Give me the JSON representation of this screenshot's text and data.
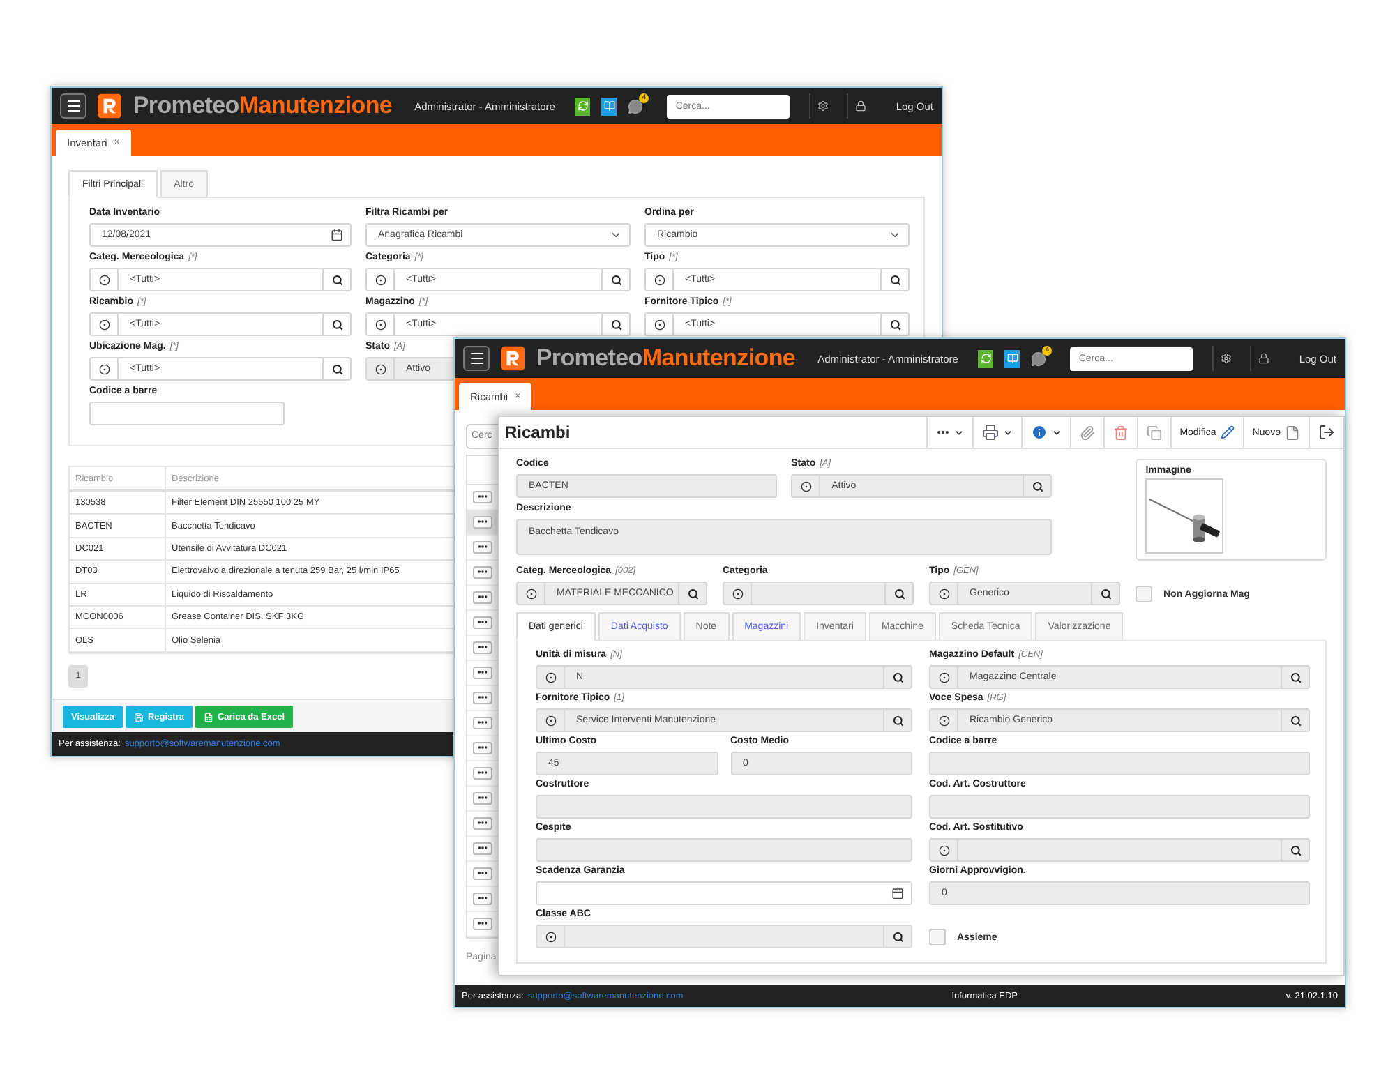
{
  "back_window": {
    "header": {
      "brand": {
        "first": "Prometeo",
        "second": "Manutenzione"
      },
      "user": "Administrator - Amministratore",
      "badge": "4",
      "search": {
        "placeholder": "Cerca..."
      },
      "logout": "Log Out"
    },
    "tabs": [
      {
        "label": "Inventari",
        "close": "×",
        "selected": true
      }
    ],
    "filter_tabs": [
      {
        "label": "Filtri Principali",
        "selected": true
      },
      {
        "label": "Altro",
        "selected": false
      }
    ],
    "form_rows": [
      [
        {
          "kind": "date",
          "label": "Data Inventario",
          "value": "12/08/2021",
          "disabled": false
        },
        {
          "kind": "select",
          "label": "Filtra Ricambi per",
          "value": "Anagrafica Ricambi",
          "disabled": false
        },
        {
          "kind": "select",
          "label": "Ordina per",
          "value": "Ricambio",
          "disabled": false
        }
      ],
      [
        {
          "kind": "lookup",
          "label": "Categ. Merceologica",
          "code": "[*]",
          "value": "<Tutti>",
          "disabled": false
        },
        {
          "kind": "lookup",
          "label": "Categoria",
          "code": "[*]",
          "value": "<Tutti>",
          "disabled": false
        },
        {
          "kind": "lookup",
          "label": "Tipo",
          "code": "[*]",
          "value": "<Tutti>",
          "disabled": false
        }
      ],
      [
        {
          "kind": "lookup",
          "label": "Ricambio",
          "code": "[*]",
          "value": "<Tutti>",
          "disabled": false
        },
        {
          "kind": "lookup",
          "label": "Magazzino",
          "code": "[*]",
          "value": "<Tutti>",
          "disabled": false
        },
        {
          "kind": "lookup",
          "label": "Fornitore Tipico",
          "code": "[*]",
          "value": "<Tutti>",
          "disabled": false
        }
      ],
      [
        {
          "kind": "lookup",
          "label": "Ubicazione Mag.",
          "code": "[*]",
          "value": "<Tutti>",
          "disabled": false
        },
        {
          "kind": "lookup",
          "label": "Stato",
          "code": "[A]",
          "value": "Attivo",
          "disabled": true
        }
      ],
      [
        {
          "kind": "short",
          "label": "Codice a barre",
          "disabled": false
        }
      ]
    ],
    "table": {
      "columns": [
        "Ricambio",
        "Descrizione"
      ],
      "rows": [
        [
          "130538",
          "Filter Element DIN 25550 100 25 MY"
        ],
        [
          "BACTEN",
          "Bacchetta Tendicavo"
        ],
        [
          "DC021",
          "Utensile di Avvitatura DC021"
        ],
        [
          "DT03",
          "Elettrovalvola direzionale a tenuta 259 Bar, 25 l/min IP65"
        ],
        [
          "LR",
          "Liquido di Riscaldamento"
        ],
        [
          "MCON0006",
          "Grease Container DIS. SKF 3KG"
        ],
        [
          "OLS",
          "Olio Selenia"
        ]
      ]
    },
    "pagination": [
      {
        "label": "1",
        "selected": true
      }
    ],
    "buttons": [
      {
        "kind": "view",
        "label": "Visualizza"
      },
      {
        "kind": "save",
        "label": "Registra"
      },
      {
        "kind": "excel",
        "label": "Carica da Excel"
      }
    ],
    "footer": {
      "label": "Per assistenza:",
      "link": "supporto@softwaremanutenzione.com"
    }
  },
  "front_window": {
    "header": {
      "brand": {
        "first": "Prometeo",
        "second": "Manutenzione"
      },
      "user": "Administrator - Amministratore",
      "badge": "4",
      "search": {
        "placeholder": "Cerca..."
      },
      "logout": "Log Out"
    },
    "tabs": [
      {
        "label": "Ricambi",
        "close": "×",
        "selected": true
      }
    ],
    "list": {
      "search": {
        "placeholder": "Cerc"
      },
      "rows": [
        {
          "selected": false
        },
        {
          "selected": true
        },
        {
          "selected": false
        },
        {
          "selected": false
        },
        {
          "selected": false
        },
        {
          "selected": false
        },
        {
          "selected": false
        },
        {
          "selected": false
        },
        {
          "selected": false
        },
        {
          "selected": false
        },
        {
          "selected": false
        },
        {
          "selected": false
        },
        {
          "selected": false
        },
        {
          "selected": false
        },
        {
          "selected": false
        },
        {
          "selected": false
        },
        {
          "selected": false
        },
        {
          "selected": false
        }
      ],
      "pager": "Pagina"
    },
    "dialog": {
      "title": "Ricambi",
      "toolbar": [
        {
          "kind": "more",
          "dropdown": true
        },
        {
          "kind": "print",
          "dropdown": true
        },
        {
          "kind": "info",
          "dropdown": true
        },
        {
          "kind": "attach",
          "dropdown": false
        },
        {
          "kind": "delete",
          "dropdown": false
        },
        {
          "kind": "copy",
          "dropdown": false
        },
        {
          "kind": "edit",
          "label": "Modifica",
          "dropdown": false
        },
        {
          "kind": "new",
          "label": "Nuovo",
          "dropdown": false
        },
        {
          "kind": "exit",
          "dropdown": false
        }
      ],
      "top_rows": [
        [
          {
            "kind": "text",
            "label": "Codice",
            "value": "BACTEN",
            "disabled": true
          },
          {
            "kind": "lookup",
            "label": "Stato",
            "code": "[A]",
            "value": "Attivo",
            "disabled": true
          }
        ],
        [
          {
            "kind": "textarea",
            "label": "Descrizione",
            "value": "Bacchetta Tendicavo",
            "disabled": true
          }
        ]
      ],
      "image": {
        "label": "Immagine",
        "kind": "picture"
      },
      "third_row": [
        {
          "kind": "lookup",
          "label": "Categ. Merceologica",
          "code": "[002]",
          "value": "MATERIALE MECCANICO",
          "disabled": true
        },
        {
          "kind": "lookup",
          "label": "Categoria",
          "disabled": true
        },
        {
          "kind": "lookup",
          "label": "Tipo",
          "code": "[GEN]",
          "value": "Generico",
          "disabled": true
        },
        {
          "kind": "checkbox",
          "label": "Non Aggiorna Mag",
          "checked": false
        }
      ],
      "tabs": [
        {
          "label": "Dati generici",
          "selected": true,
          "highlighted": false
        },
        {
          "label": "Dati Acquisto",
          "selected": false,
          "highlighted": true
        },
        {
          "label": "Note",
          "selected": false,
          "highlighted": false
        },
        {
          "label": "Magazzini",
          "selected": false,
          "highlighted": true
        },
        {
          "label": "Inventari",
          "selected": false,
          "highlighted": false
        },
        {
          "label": "Macchine",
          "selected": false,
          "highlighted": false
        },
        {
          "label": "Scheda Tecnica",
          "selected": false,
          "highlighted": false
        },
        {
          "label": "Valorizzazione",
          "selected": false,
          "highlighted": false
        }
      ],
      "tab_rows": [
        [
          {
            "kind": "lookup",
            "label": "Unità di misura",
            "code": "[N]",
            "value": "N",
            "disabled": true
          },
          {
            "kind": "lookup",
            "label": "Magazzino Default",
            "code": "[CEN]",
            "value": "Magazzino Centrale",
            "disabled": true
          }
        ],
        [
          {
            "kind": "lookup",
            "label": "Fornitore Tipico",
            "code": "[1]",
            "value": "Service Interventi Manutenzione",
            "disabled": true
          },
          {
            "kind": "lookup",
            "label": "Voce Spesa",
            "code": "[RG]",
            "value": "Ricambio Generico",
            "disabled": true
          }
        ],
        [
          {
            "kind": "pair",
            "fields": [
              {
                "kind": "text",
                "label": "Ultimo Costo",
                "value": "45",
                "disabled": true
              },
              {
                "kind": "text",
                "label": "Costo Medio",
                "value": "0",
                "disabled": true
              }
            ]
          },
          {
            "kind": "text",
            "label": "Codice a barre",
            "disabled": true
          }
        ],
        [
          {
            "kind": "text",
            "label": "Costruttore",
            "disabled": true
          },
          {
            "kind": "text",
            "label": "Cod. Art. Costruttore",
            "disabled": true
          }
        ],
        [
          {
            "kind": "text",
            "label": "Cespite",
            "disabled": true
          },
          {
            "kind": "lookup",
            "label": "Cod. Art. Sostitutivo",
            "disabled": true
          }
        ],
        [
          {
            "kind": "date",
            "label": "Scadenza Garanzia",
            "disabled": false
          },
          {
            "kind": "text",
            "label": "Giorni Approvvigion.",
            "value": "0",
            "disabled": true
          }
        ],
        [
          {
            "kind": "lookup",
            "label": "Classe ABC",
            "disabled": true
          },
          {
            "kind": "checkbox",
            "label": "Assieme",
            "checked": false
          }
        ]
      ]
    },
    "footer": {
      "label": "Per assistenza:",
      "link": "supporto@softwaremanutenzione.com",
      "company": "Informatica EDP",
      "version": "v. 21.02.1.10"
    }
  }
}
